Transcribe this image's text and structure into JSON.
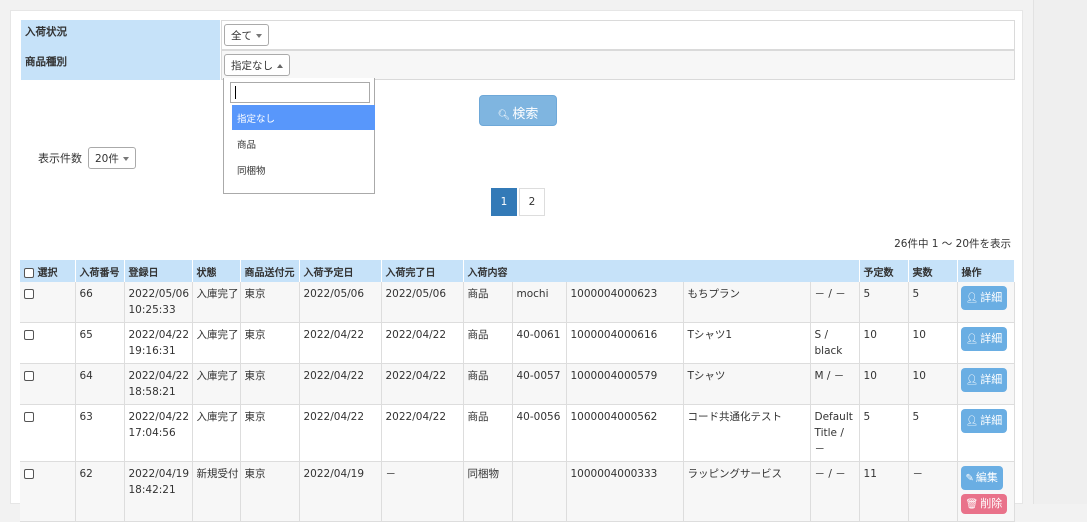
{
  "filters": {
    "arrival_status": {
      "label": "入荷状況",
      "value": "全て"
    },
    "product_type": {
      "label": "商品種別",
      "value": "指定なし"
    }
  },
  "dropdown": {
    "search_value": "",
    "options": [
      "指定なし",
      "商品",
      "同梱物"
    ],
    "selected_index": 0
  },
  "search_button": {
    "label": "検索"
  },
  "page_size": {
    "label": "表示件数",
    "value": "20件"
  },
  "pagination": {
    "pages": [
      "1",
      "2"
    ],
    "active": "1"
  },
  "result_info": "26件中 1 ～ 20件を表示",
  "table": {
    "headers": {
      "select": "選択",
      "arrival_no": "入荷番号",
      "registered": "登録日",
      "status": "状態",
      "sender": "商品送付元",
      "planned_date": "入荷予定日",
      "completed_date": "入荷完了日",
      "content": "入荷内容",
      "planned_qty": "予定数",
      "actual_qty": "実数",
      "actions": "操作"
    },
    "rows": [
      {
        "no": "66",
        "reg_date": "2022/05/06",
        "reg_time": "10:25:33",
        "status": "入庫完了",
        "sender": "東京",
        "planned": "2022/05/06",
        "completed": "2022/05/06",
        "kind": "商品",
        "code": "mochi",
        "jan": "1000004000623",
        "name": "もちプラン",
        "variant": "－ / －",
        "planned_qty": "5",
        "actual_qty": "5",
        "action": "詳細"
      },
      {
        "no": "65",
        "reg_date": "2022/04/22",
        "reg_time": "19:16:31",
        "status": "入庫完了",
        "sender": "東京",
        "planned": "2022/04/22",
        "completed": "2022/04/22",
        "kind": "商品",
        "code": "40-0061",
        "jan": "1000004000616",
        "name": "Tシャツ1",
        "variant": "S /\nblack",
        "planned_qty": "10",
        "actual_qty": "10",
        "action": "詳細"
      },
      {
        "no": "64",
        "reg_date": "2022/04/22",
        "reg_time": "18:58:21",
        "status": "入庫完了",
        "sender": "東京",
        "planned": "2022/04/22",
        "completed": "2022/04/22",
        "kind": "商品",
        "code": "40-0057",
        "jan": "1000004000579",
        "name": "Tシャツ",
        "variant": "M / －",
        "planned_qty": "10",
        "actual_qty": "10",
        "action": "詳細"
      },
      {
        "no": "63",
        "reg_date": "2022/04/22",
        "reg_time": "17:04:56",
        "status": "入庫完了",
        "sender": "東京",
        "planned": "2022/04/22",
        "completed": "2022/04/22",
        "kind": "商品",
        "code": "40-0056",
        "jan": "1000004000562",
        "name": "コード共通化テスト",
        "variant": "Default\nTitle /\n－",
        "planned_qty": "5",
        "actual_qty": "5",
        "action": "詳細"
      },
      {
        "no": "62",
        "reg_date": "2022/04/19",
        "reg_time": "18:42:21",
        "status": "新規受付",
        "sender": "東京",
        "planned": "2022/04/19",
        "completed": "－",
        "kind": "同梱物",
        "code": "",
        "jan": "1000004000333",
        "name": "ラッピングサービス",
        "variant": "－ / －",
        "planned_qty": "11",
        "actual_qty": "－",
        "action": "編集",
        "action2": "削除"
      }
    ]
  }
}
